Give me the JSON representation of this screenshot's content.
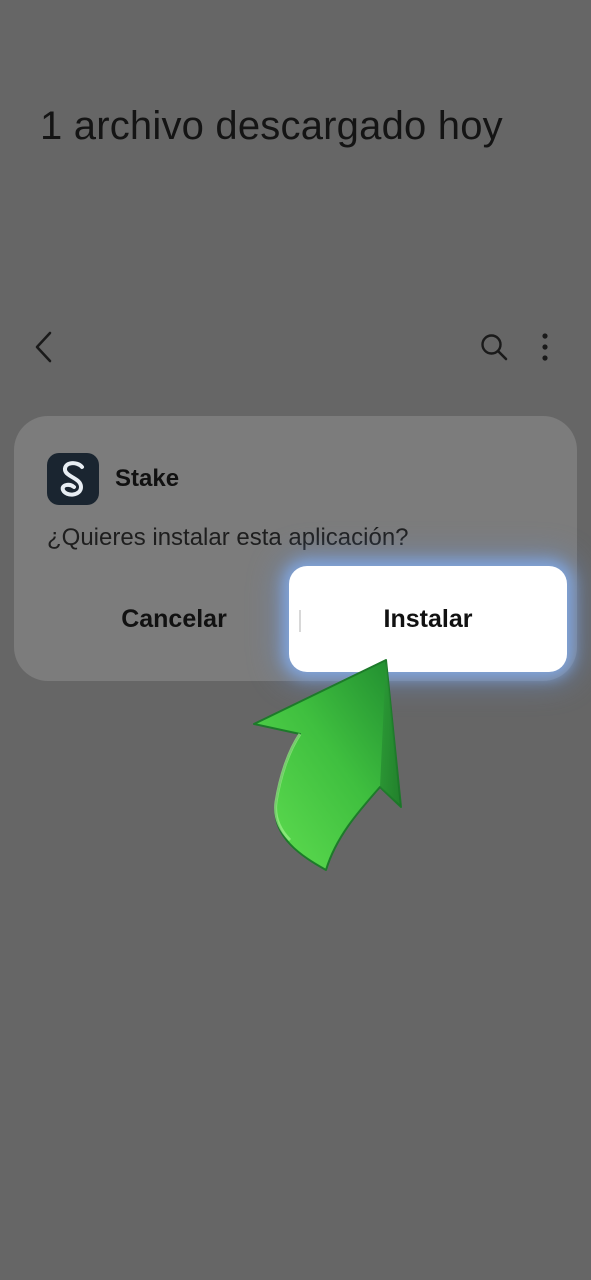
{
  "page": {
    "title": "1 archivo descargado hoy"
  },
  "toolbar": {
    "back_icon": "chevron-left-icon",
    "search_icon": "search-icon",
    "more_icon": "more-vertical-icon"
  },
  "dialog": {
    "app_name": "Stake",
    "app_icon": "stake-app-icon",
    "question": "¿Quieres instalar esta aplicación?",
    "cancel_label": "Cancelar",
    "install_label": "Instalar"
  },
  "overlay": {
    "arrow_icon": "green-arrow-icon",
    "arrow_color": "#3fbf3f"
  },
  "colors": {
    "background": "#666666",
    "dialog": "#7c7c7c",
    "install_button": "#ffffff",
    "glow": "#82aae6"
  }
}
